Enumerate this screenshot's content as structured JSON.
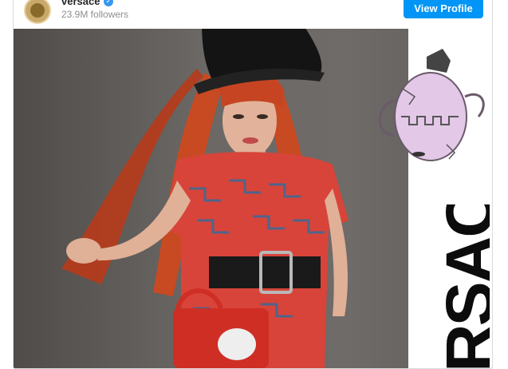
{
  "profile": {
    "username": "versace",
    "followers": "23.9M followers",
    "verified_icon": "verified-badge-icon",
    "view_profile_label": "View Profile"
  },
  "post": {
    "image_text": "RSACE"
  },
  "colors": {
    "accent": "#0095f6",
    "hair": "#c2401e",
    "dress": "#d8443a"
  }
}
